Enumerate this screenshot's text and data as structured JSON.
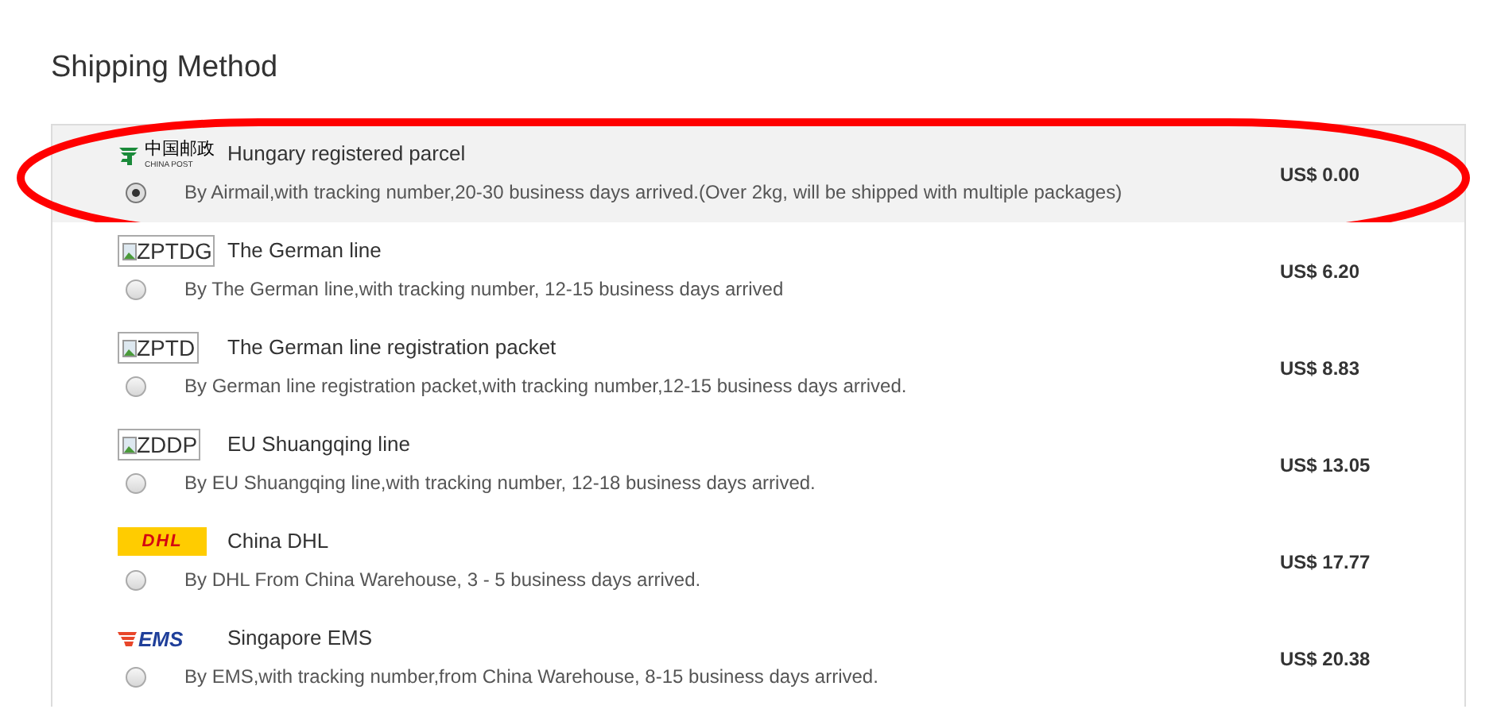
{
  "title": "Shipping Method",
  "options": [
    {
      "logo": {
        "kind": "china_post",
        "text": "中国邮政",
        "subtext": "CHINA POST"
      },
      "name": "Hungary registered parcel",
      "description": "By Airmail,with tracking number,20-30 business days arrived.(Over 2kg, will be shipped with multiple packages)",
      "price": "US$ 0.00",
      "selected": true,
      "highlighted": true
    },
    {
      "logo": {
        "kind": "broken_image",
        "text": "ZPTDG"
      },
      "name": "The German line",
      "description": "By The German line,with tracking number, 12-15 business days arrived",
      "price": "US$ 6.20",
      "selected": false,
      "highlighted": false
    },
    {
      "logo": {
        "kind": "broken_image",
        "text": "ZPTD"
      },
      "name": "The German line registration packet",
      "description": "By German line registration packet,with tracking number,12-15 business days arrived.",
      "price": "US$ 8.83",
      "selected": false,
      "highlighted": false
    },
    {
      "logo": {
        "kind": "broken_image",
        "text": "ZDDP"
      },
      "name": "EU Shuangqing line",
      "description": "By EU Shuangqing line,with tracking number, 12-18 business days arrived.",
      "price": "US$ 13.05",
      "selected": false,
      "highlighted": false
    },
    {
      "logo": {
        "kind": "dhl",
        "text": "DHL"
      },
      "name": "China DHL",
      "description": "By DHL From China Warehouse, 3 - 5 business days arrived.",
      "price": "US$ 17.77",
      "selected": false,
      "highlighted": false
    },
    {
      "logo": {
        "kind": "ems",
        "text": "EMS"
      },
      "name": "Singapore EMS",
      "description": "By EMS,with tracking number,from China Warehouse, 8-15 business days arrived.",
      "price": "US$ 20.38",
      "selected": false,
      "highlighted": false
    }
  ]
}
